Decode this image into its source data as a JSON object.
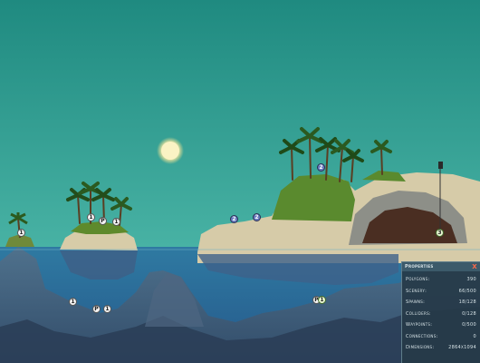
{
  "markers": [
    {
      "id": "m1",
      "label": "1"
    },
    {
      "id": "m2",
      "label": "1"
    },
    {
      "id": "m3",
      "label": "P"
    },
    {
      "id": "m4",
      "label": "1"
    },
    {
      "id": "m5",
      "label": "2"
    },
    {
      "id": "m6",
      "label": "2"
    },
    {
      "id": "m7",
      "label": "2"
    },
    {
      "id": "m8",
      "label": "3"
    },
    {
      "id": "m9",
      "label": "1"
    },
    {
      "id": "m10",
      "label": "P"
    },
    {
      "id": "m11",
      "label": "1"
    },
    {
      "id": "m12",
      "label": "P"
    },
    {
      "id": "m13",
      "label": "1"
    }
  ],
  "properties_panel": {
    "title": "Properties",
    "close_label": "X",
    "rows": [
      {
        "label": "Polygons:",
        "value": "390"
      },
      {
        "label": "Scenery:",
        "value": "66/500"
      },
      {
        "label": "Spawns:",
        "value": "18/128"
      },
      {
        "label": "Colliders:",
        "value": "0/128"
      },
      {
        "label": "Waypoints:",
        "value": "0/500"
      },
      {
        "label": "Connections:",
        "value": "0"
      },
      {
        "label": "Dimensions:",
        "value": "2864x1094"
      }
    ]
  },
  "colors": {
    "sky_top": "#1f8a80",
    "sky_bottom": "#48b3a4",
    "water": "#2e6f9a",
    "sand": "#d9cfb0",
    "grass": "#5e8a2c",
    "panel": "#263a48"
  }
}
